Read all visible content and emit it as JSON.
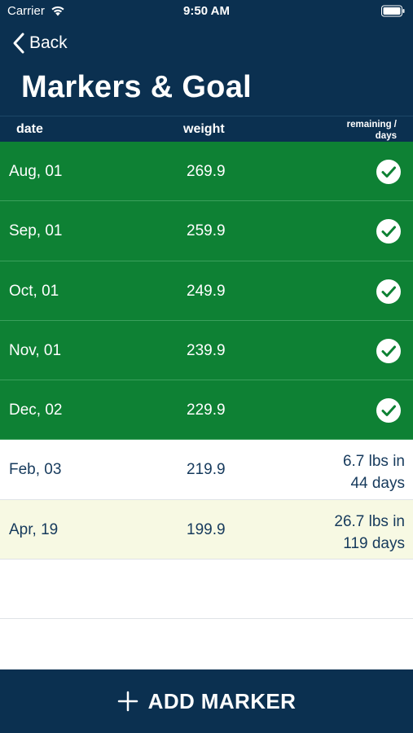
{
  "status_bar": {
    "carrier": "Carrier",
    "time": "9:50 AM"
  },
  "nav": {
    "back_label": "Back",
    "title": "Markers & Goal"
  },
  "table": {
    "headers": {
      "date": "date",
      "weight": "weight",
      "remaining_line1": "remaining /",
      "remaining_line2": "days"
    },
    "rows": [
      {
        "date": "Aug, 01",
        "weight": "269.9",
        "state": "done"
      },
      {
        "date": "Sep, 01",
        "weight": "259.9",
        "state": "done"
      },
      {
        "date": "Oct, 01",
        "weight": "249.9",
        "state": "done"
      },
      {
        "date": "Nov, 01",
        "weight": "239.9",
        "state": "done"
      },
      {
        "date": "Dec, 02",
        "weight": "229.9",
        "state": "done"
      },
      {
        "date": "Feb, 03",
        "weight": "219.9",
        "state": "pending",
        "remaining_line1": "6.7 lbs in",
        "remaining_line2": "44 days"
      },
      {
        "date": "Apr, 19",
        "weight": "199.9",
        "state": "goal",
        "remaining_line1": "26.7 lbs in",
        "remaining_line2": "119 days"
      }
    ]
  },
  "footer": {
    "add_label": "ADD MARKER"
  },
  "colors": {
    "navy": "#0b3050",
    "done_green": "#0e8134",
    "goal_highlight": "#f7f9e3",
    "text_dark": "#163a5c"
  },
  "icons": {
    "back": "chevron-left-icon",
    "check": "checkmark-circle-icon",
    "add": "plus-icon",
    "wifi": "wifi-icon",
    "battery": "battery-icon"
  }
}
